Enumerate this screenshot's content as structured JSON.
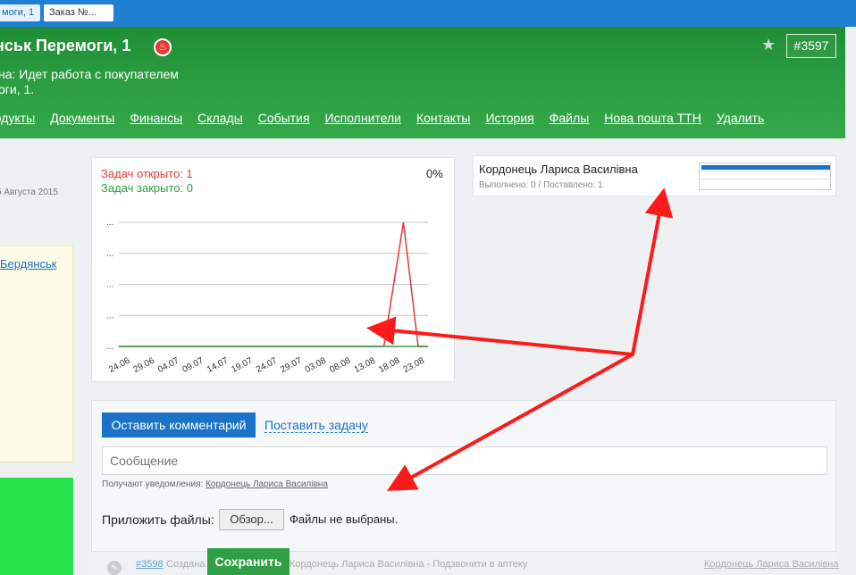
{
  "tabs": [
    {
      "label": "моги, 1",
      "active": true
    },
    {
      "label": "Заказ №...",
      "active": false
    }
  ],
  "header": {
    "title": "нськ Перемоги, 1",
    "fire_icon": "fire-icon",
    "favorite_icon": "star-icon",
    "order_badge": "#3597",
    "status": "на: Идет работа с покупателем",
    "address": "оги, 1.",
    "nav": [
      "родукты",
      "Документы",
      "Финансы",
      "Склады",
      "События",
      "Исполнители",
      "Контакты",
      "История",
      "Файлы",
      "Нова пошта ТТН",
      "Удалить"
    ]
  },
  "left": {
    "date": "5 Августа 2015",
    "city_link": "Бердянськ"
  },
  "tasks_chart": {
    "open_label": "Задач открыто: 1",
    "closed_label": "Задач закрыто: 0",
    "percent": "0%",
    "colors": {
      "open": "#e53935",
      "closed": "#2ea043",
      "grid": "#c8c8c8"
    }
  },
  "chart_data": {
    "type": "line",
    "x": [
      "24.06",
      "29.06",
      "04.07",
      "09.07",
      "14.07",
      "19.07",
      "24.07",
      "29.07",
      "03.08",
      "08.08",
      "13.08",
      "18.08",
      "23.08"
    ],
    "x_daily_span": [
      "24.06",
      "26.08"
    ],
    "series": [
      {
        "key": "open",
        "points": [
          [
            "24.06",
            0
          ],
          [
            "17.08",
            0
          ],
          [
            "21.08",
            1
          ],
          [
            "24.08",
            0
          ],
          [
            "26.08",
            0
          ]
        ]
      },
      {
        "key": "closed",
        "points": [
          [
            "24.06",
            0
          ],
          [
            "26.08",
            0
          ]
        ]
      }
    ],
    "y_tick_labels": [
      "...",
      "...",
      "...",
      "...",
      "..."
    ],
    "ylim": [
      0,
      1
    ],
    "grid": true
  },
  "assignee": {
    "name": "Кордонець Лариса Василівна",
    "progress_text": "Выполнено: 0 / Поставлено: 1",
    "progress_fraction": 1.0
  },
  "comment": {
    "leave_comment_label": "Оставить комментарий",
    "set_task_label": "Поставить задачу",
    "message_placeholder": "Сообщение",
    "notify_prefix": "Получают уведомления:",
    "notify_user": "Кордонець Лариса Василівна",
    "attach_label": "Приложить файлы:",
    "browse_label": "Обзор...",
    "no_files": "Файлы не выбраны."
  },
  "history": {
    "id_link": "#3598",
    "created": "Создана",
    "text": "Кордонець Лариса Василівна - Подзвонити в аптеку",
    "user": "Кордонець Лариса Василівна",
    "icon": "pencil-icon"
  },
  "save_label": "Сохранить"
}
